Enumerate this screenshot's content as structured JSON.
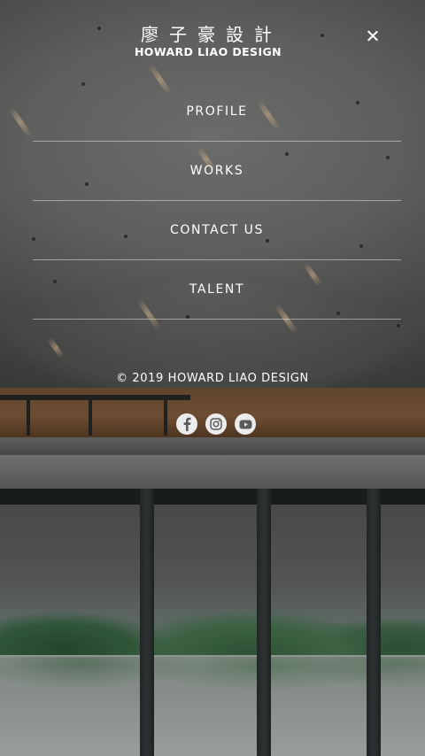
{
  "brand": {
    "name_cn": "廖子豪設計",
    "name_en": "HOWARD LIAO DESIGN"
  },
  "header": {
    "close_icon": "close-icon"
  },
  "menu": {
    "items": [
      {
        "label": "PROFILE"
      },
      {
        "label": "WORKS"
      },
      {
        "label": "CONTACT US"
      },
      {
        "label": "TALENT"
      }
    ]
  },
  "footer": {
    "copyright": "© 2019 HOWARD LIAO DESIGN",
    "social": [
      {
        "icon": "facebook-icon"
      },
      {
        "icon": "instagram-icon"
      },
      {
        "icon": "youtube-icon"
      }
    ]
  },
  "colors": {
    "text": "#ffffff",
    "divider": "rgba(255,255,255,0.45)",
    "social_bg": "#ececec",
    "social_glyph": "#5a5a5a"
  }
}
